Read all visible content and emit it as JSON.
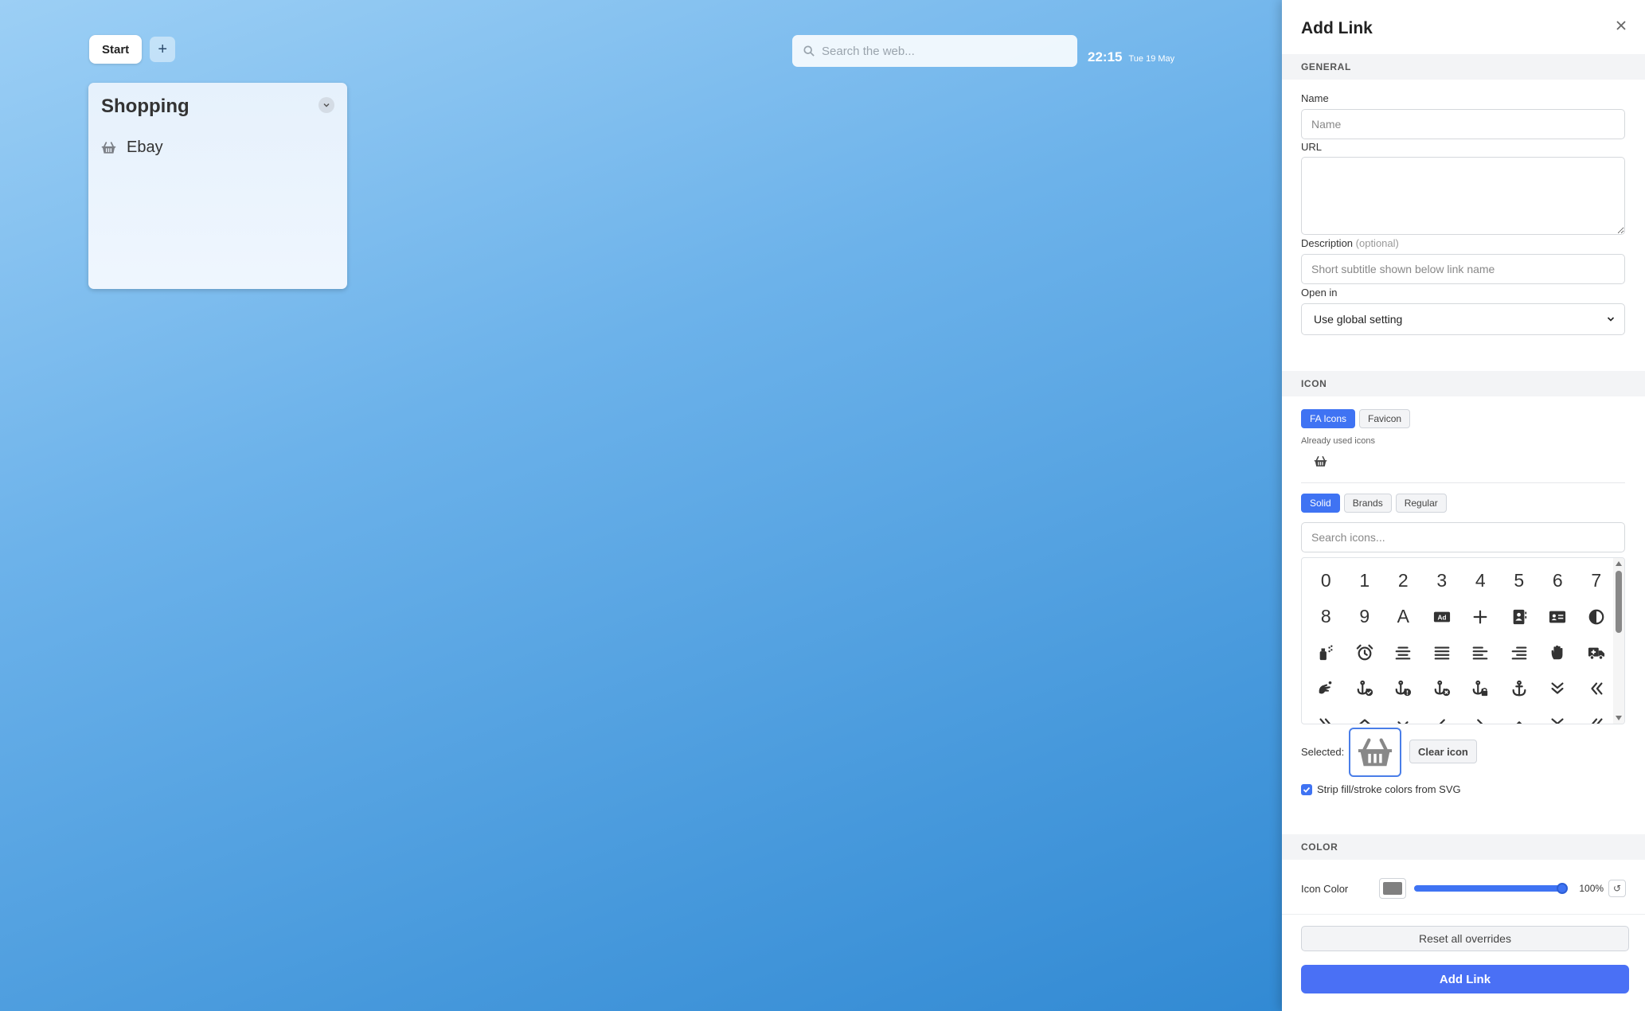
{
  "topbar": {
    "tab_start": "Start",
    "tab_add": "+",
    "search_placeholder": "Search the web...",
    "time": "22:15",
    "date": "Tue 19 May"
  },
  "card": {
    "title": "Shopping",
    "links": [
      {
        "label": "Ebay",
        "icon": "basket-shopping-icon"
      }
    ]
  },
  "panel": {
    "title": "Add Link",
    "sections": {
      "general": "GENERAL",
      "icon": "ICON",
      "color": "COLOR"
    },
    "name": {
      "label": "Name",
      "placeholder": "Name",
      "value": ""
    },
    "url": {
      "label": "URL",
      "value": ""
    },
    "description": {
      "label": "Description",
      "optional": "(optional)",
      "placeholder": "Short subtitle shown below link name"
    },
    "open_in": {
      "label": "Open in",
      "value": "Use global setting"
    },
    "icon_source_tabs": [
      {
        "label": "FA Icons",
        "active": true
      },
      {
        "label": "Favicon",
        "active": false
      }
    ],
    "already_used": "Already used icons",
    "style_tabs": [
      {
        "label": "Solid",
        "active": true
      },
      {
        "label": "Brands",
        "active": false
      },
      {
        "label": "Regular",
        "active": false
      }
    ],
    "icon_search_placeholder": "Search icons...",
    "icon_grid": [
      "0",
      "1",
      "2",
      "3",
      "4",
      "5",
      "6",
      "7",
      "8",
      "9",
      "A",
      "ad-icon",
      "plus-icon",
      "address-book-icon",
      "address-card-icon",
      "circle-half-icon",
      "spray-can-icon",
      "alarm-clock-icon",
      "align-center-icon",
      "align-justify-icon",
      "align-left-icon",
      "align-right-icon",
      "hand-icon",
      "truck-medical-icon",
      "hands-asl-icon",
      "anchor-circle-check-icon",
      "anchor-circle-exclamation-icon",
      "anchor-circle-xmark-icon",
      "anchor-lock-icon",
      "anchor-icon",
      "angles-down-icon",
      "angles-left-icon",
      "angles-right-icon",
      "angles-up-icon",
      "angle-down-icon",
      "angle-left-icon",
      "angle-right-icon",
      "angle-up-icon",
      "angles-down-icon",
      "angles-left-icon"
    ],
    "selected_label": "Selected:",
    "clear_icon": "Clear icon",
    "strip_colors": "Strip fill/stroke colors from SVG",
    "icon_color": {
      "label": "Icon Color",
      "swatch": "#808080",
      "opacity": 100,
      "opacity_text": "100%"
    },
    "reset_overrides": "Reset all overrides",
    "submit": "Add Link"
  },
  "colors": {
    "accent": "#3f73f3",
    "submit": "#4a70f5"
  }
}
